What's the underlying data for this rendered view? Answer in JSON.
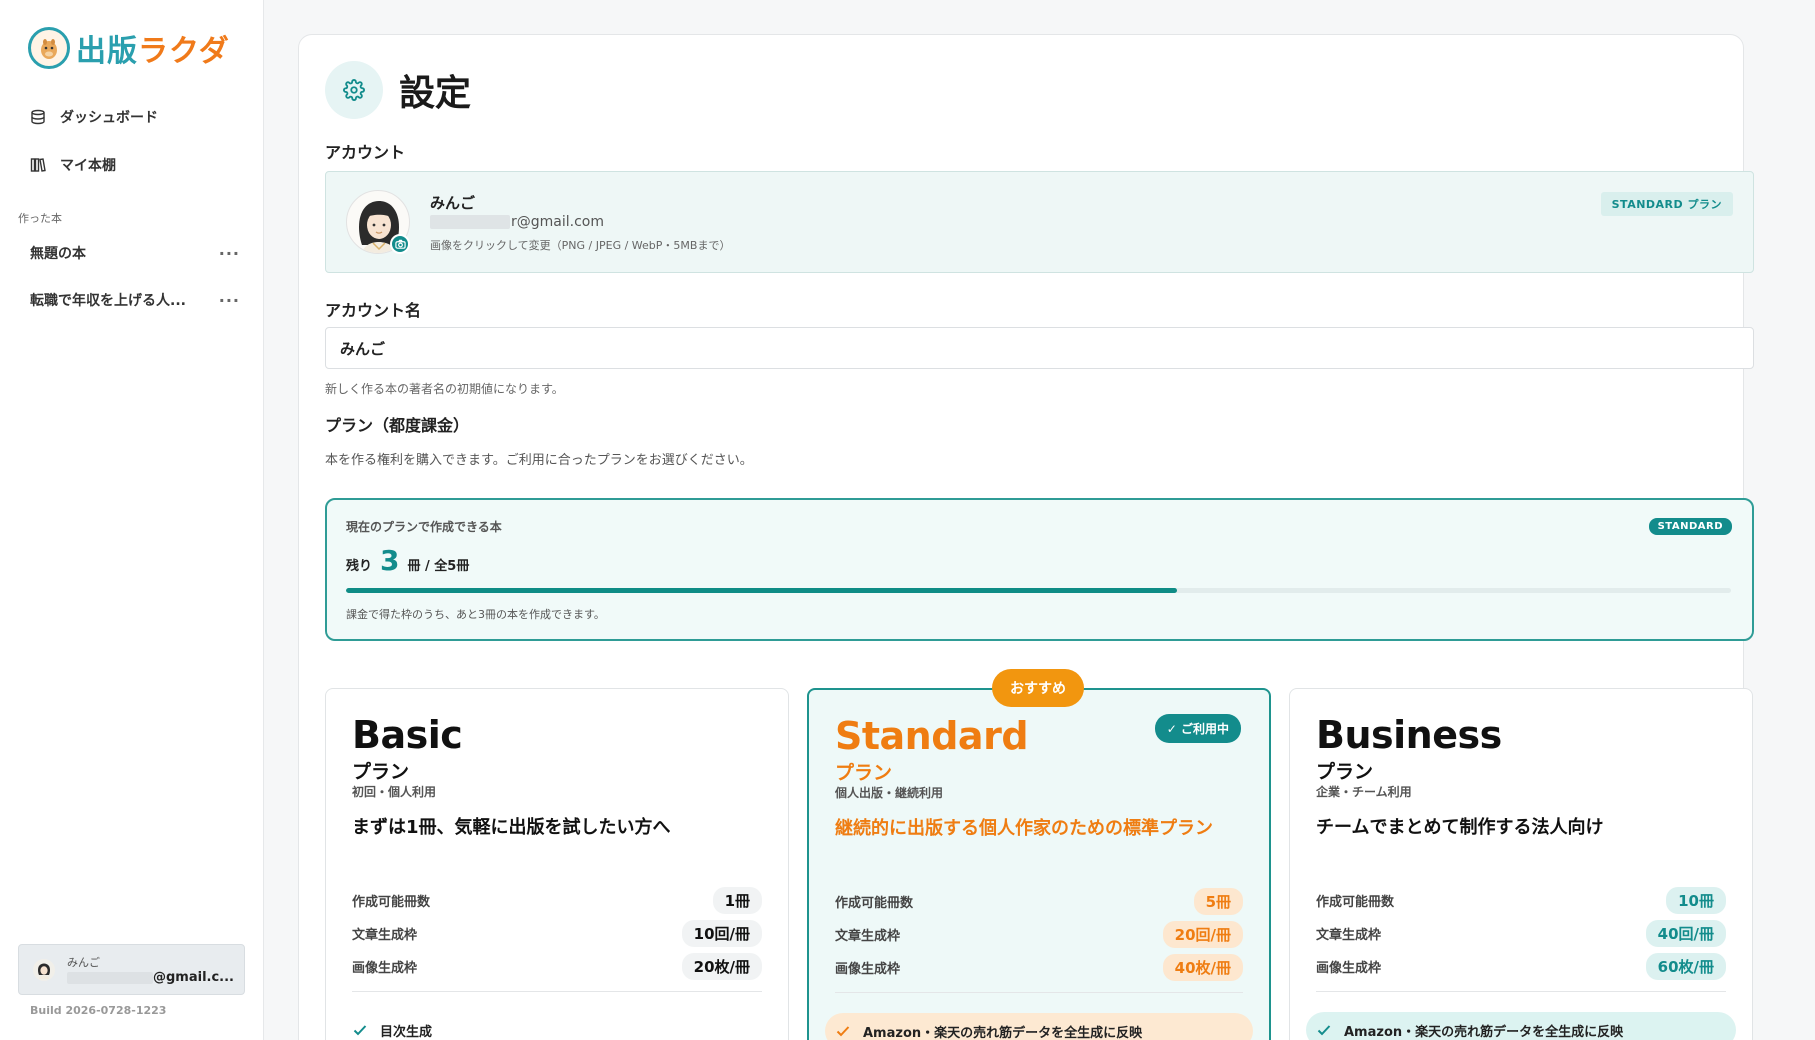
{
  "brand": {
    "part1": "出版",
    "part2": "ラクダ"
  },
  "sidebar": {
    "nav": [
      {
        "label": "ダッシュボード",
        "icon": "database-icon"
      },
      {
        "label": "マイ本棚",
        "icon": "bookshelf-icon"
      }
    ],
    "section_label": "作った本",
    "books": [
      {
        "title": "無題の本",
        "menu": "···"
      },
      {
        "title": "転職で年収を上げる人...",
        "menu": "···"
      }
    ],
    "user": {
      "name": "みんご",
      "email_suffix": "@gmail.c..."
    },
    "build": "Build 2026-0728-1223"
  },
  "page": {
    "title": "設定",
    "account_section": "アカウント",
    "account": {
      "name": "みんご",
      "email_suffix": "r@gmail.com",
      "hint": "画像をクリックして変更（PNG / JPEG / WebP・5MBまで）",
      "plan_tag": "STANDARD プラン"
    },
    "account_name_label": "アカウント名",
    "account_name_value": "みんご",
    "account_name_help": "新しく作る本の著者名の初期値になります。",
    "plan_section": "プラン（都度課金）",
    "plan_desc": "本を作る権利を購入できます。ご利用に合ったプランをお選びください。",
    "quota": {
      "title": "現在のプランで作成できる本",
      "badge": "STANDARD",
      "prefix": "残り",
      "remaining": "3",
      "suffix": "冊 / 全5冊",
      "progress_fraction": 0.6,
      "note": "課金で得た枠のうち、あと3冊の本を作成できます。"
    }
  },
  "plans": [
    {
      "name": "Basic",
      "sub": "プラン",
      "meta": "初回・個人利用",
      "lead": "まずは1冊、気軽に出版を試したい方へ",
      "stats": [
        {
          "label": "作成可能冊数",
          "value": "1冊"
        },
        {
          "label": "文章生成枠",
          "value": "10回/冊"
        },
        {
          "label": "画像生成枠",
          "value": "20枚/冊"
        }
      ],
      "feature": "目次生成"
    },
    {
      "name": "Standard",
      "sub": "プラン",
      "meta": "個人出版・継続利用",
      "lead": "継続的に出版する個人作家のための標準プラン",
      "recommended": "おすすめ",
      "current": "ご利用中",
      "stats": [
        {
          "label": "作成可能冊数",
          "value": "5冊"
        },
        {
          "label": "文章生成枠",
          "value": "20回/冊"
        },
        {
          "label": "画像生成枠",
          "value": "40枚/冊"
        }
      ],
      "feature": "Amazon・楽天の売れ筋データを全生成に反映"
    },
    {
      "name": "Business",
      "sub": "プラン",
      "meta": "企業・チーム利用",
      "lead": "チームでまとめて制作する法人向け",
      "stats": [
        {
          "label": "作成可能冊数",
          "value": "10冊"
        },
        {
          "label": "文章生成枠",
          "value": "40回/冊"
        },
        {
          "label": "画像生成枠",
          "value": "60枚/冊"
        }
      ],
      "feature": "Amazon・楽天の売れ筋データを全生成に反映"
    }
  ],
  "colors": {
    "teal": "#138c8c",
    "orange": "#ef7d12",
    "badge_orange": "#f2960f"
  }
}
